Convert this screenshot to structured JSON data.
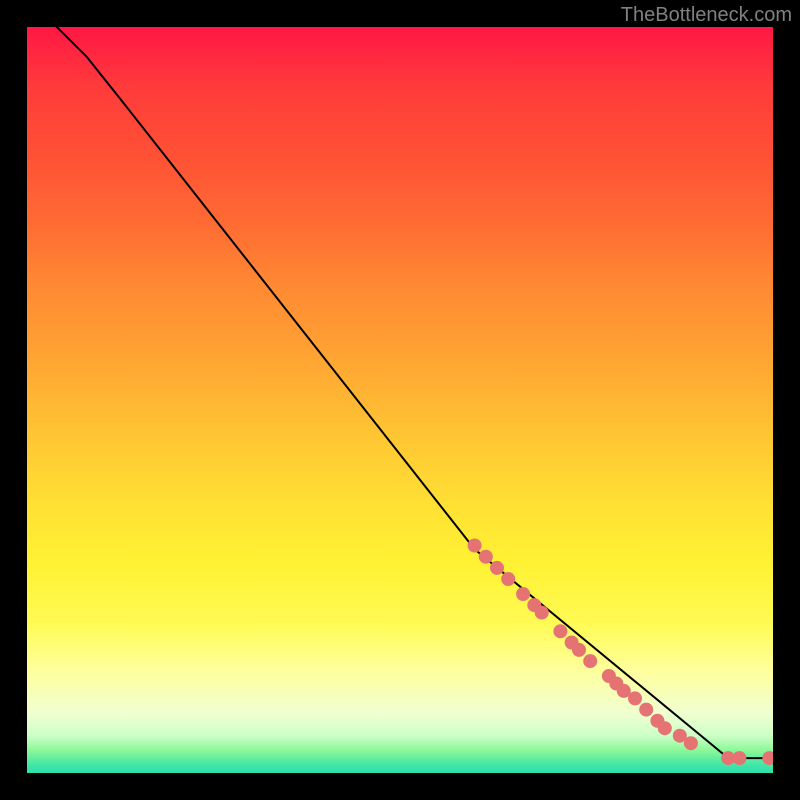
{
  "attribution": "TheBottleneck.com",
  "chart_data": {
    "type": "line",
    "title": "",
    "xlabel": "",
    "ylabel": "",
    "xlim": [
      0,
      100
    ],
    "ylim": [
      0,
      100
    ],
    "curve": {
      "name": "curve",
      "x": [
        0,
        4,
        8,
        12,
        60,
        94,
        100
      ],
      "y": [
        103,
        100,
        96,
        91,
        30,
        2,
        2
      ]
    },
    "marker_series": {
      "name": "markers",
      "points": [
        {
          "x": 60.0,
          "y": 30.5
        },
        {
          "x": 61.5,
          "y": 29.0
        },
        {
          "x": 63.0,
          "y": 27.5
        },
        {
          "x": 64.5,
          "y": 26.0
        },
        {
          "x": 66.5,
          "y": 24.0
        },
        {
          "x": 68.0,
          "y": 22.5
        },
        {
          "x": 69.0,
          "y": 21.5
        },
        {
          "x": 71.5,
          "y": 19.0
        },
        {
          "x": 73.0,
          "y": 17.5
        },
        {
          "x": 74.0,
          "y": 16.5
        },
        {
          "x": 75.5,
          "y": 15.0
        },
        {
          "x": 78.0,
          "y": 13.0
        },
        {
          "x": 79.0,
          "y": 12.0
        },
        {
          "x": 80.0,
          "y": 11.0
        },
        {
          "x": 81.5,
          "y": 10.0
        },
        {
          "x": 83.0,
          "y": 8.5
        },
        {
          "x": 84.5,
          "y": 7.0
        },
        {
          "x": 85.5,
          "y": 6.0
        },
        {
          "x": 87.5,
          "y": 5.0
        },
        {
          "x": 89.0,
          "y": 4.0
        },
        {
          "x": 94.0,
          "y": 2.0
        },
        {
          "x": 95.5,
          "y": 2.0
        },
        {
          "x": 99.5,
          "y": 2.0
        }
      ]
    },
    "marker_color": "#e57373",
    "line_color": "#000000"
  }
}
